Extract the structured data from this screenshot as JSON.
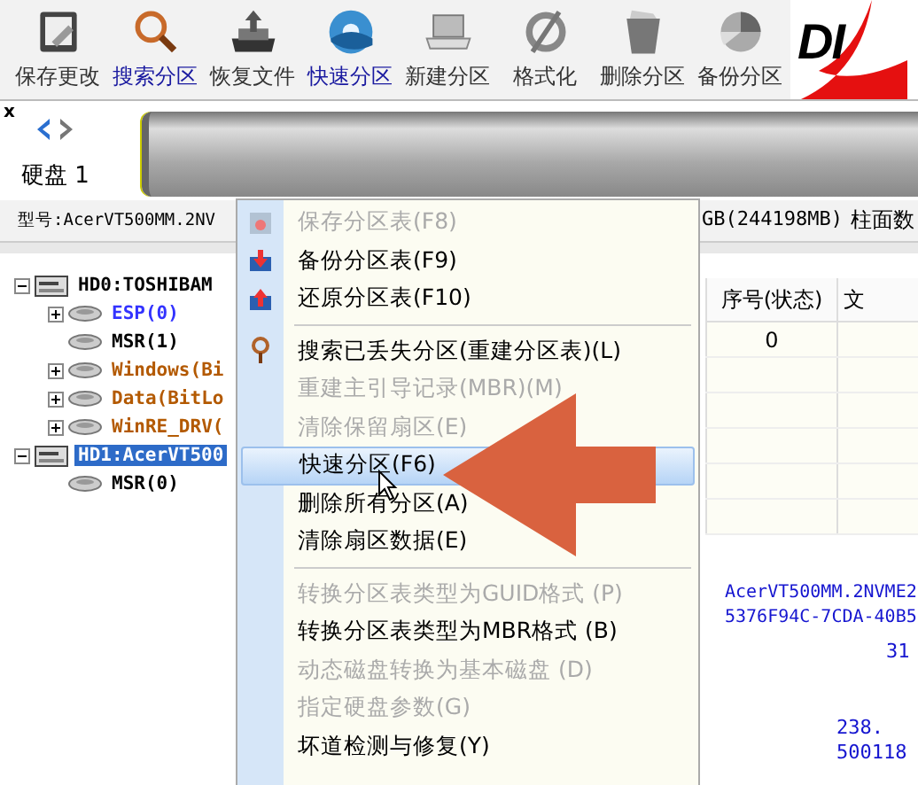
{
  "toolbar": {
    "buttons": [
      {
        "label": "保存更改",
        "kind": "save",
        "highlighted": false
      },
      {
        "label": "搜索分区",
        "kind": "search",
        "highlighted": true
      },
      {
        "label": "恢复文件",
        "kind": "restore",
        "highlighted": false
      },
      {
        "label": "快速分区",
        "kind": "disc",
        "highlighted": true
      },
      {
        "label": "新建分区",
        "kind": "laptop",
        "highlighted": false
      },
      {
        "label": "格式化",
        "kind": "format",
        "highlighted": false
      },
      {
        "label": "删除分区",
        "kind": "trash",
        "highlighted": false
      },
      {
        "label": "备份分区",
        "kind": "backup",
        "highlighted": false
      }
    ],
    "logo_text": "DI"
  },
  "disk_bar": {
    "close": "x",
    "label": "硬盘 1"
  },
  "info_line": {
    "model": "型号:AcerVT500MM.2NV",
    "capacity": "GB(244198MB)",
    "cylinders": "柱面数"
  },
  "tree": [
    {
      "label": "HD0:TOSHIBAM",
      "expanded": true,
      "selected": false,
      "color": "#000000",
      "children": [
        {
          "label": "ESP(0)",
          "expanded": false,
          "selected": false,
          "color": "#3333ff"
        },
        {
          "label": "MSR(1)",
          "selected": false,
          "color": "#000000"
        },
        {
          "label": "Windows(Bi",
          "expanded": false,
          "selected": false,
          "color": "#b35900"
        },
        {
          "label": "Data(BitLo",
          "expanded": false,
          "selected": false,
          "color": "#b35900"
        },
        {
          "label": "WinRE_DRV(",
          "expanded": false,
          "selected": false,
          "color": "#b35900"
        }
      ]
    },
    {
      "label": "HD1:AcerVT500",
      "expanded": true,
      "selected": true,
      "children": [
        {
          "label": "MSR(0)",
          "selected": false,
          "color": "#000000"
        }
      ]
    }
  ],
  "table": {
    "columns": [
      "序号(状态)",
      "文"
    ],
    "rows": [
      [
        "0",
        ""
      ]
    ]
  },
  "details": {
    "lines": [
      "AcerVT500MM.2NVME2",
      "5376F94C-7CDA-40B5"
    ],
    "numbers": [
      "31",
      "238.",
      "500118"
    ]
  },
  "context_menu": {
    "items": [
      {
        "kind": "item",
        "label": "保存分区表(F8)",
        "disabled": true,
        "selected": false
      },
      {
        "kind": "item",
        "label": "备份分区表(F9)",
        "disabled": false,
        "selected": false
      },
      {
        "kind": "item",
        "label": "还原分区表(F10)",
        "disabled": false,
        "selected": false
      },
      {
        "kind": "separator"
      },
      {
        "kind": "item",
        "label": "搜索已丢失分区(重建分区表)(L)",
        "disabled": false,
        "selected": false
      },
      {
        "kind": "item",
        "label": "重建主引导记录(MBR)(M)",
        "disabled": true,
        "selected": false
      },
      {
        "kind": "item",
        "label": "清除保留扇区(E)",
        "disabled": true,
        "selected": false
      },
      {
        "kind": "item",
        "label": "快速分区(F6)",
        "disabled": false,
        "selected": true
      },
      {
        "kind": "item",
        "label": "删除所有分区(A)",
        "disabled": false,
        "selected": false
      },
      {
        "kind": "item",
        "label": "清除扇区数据(E)",
        "disabled": false,
        "selected": false
      },
      {
        "kind": "separator"
      },
      {
        "kind": "item",
        "label": "转换分区表类型为GUID格式 (P)",
        "disabled": true,
        "selected": false
      },
      {
        "kind": "item",
        "label": "转换分区表类型为MBR格式 (B)",
        "disabled": false,
        "selected": false
      },
      {
        "kind": "item",
        "label": "动态磁盘转换为基本磁盘 (D)",
        "disabled": true,
        "selected": false
      },
      {
        "kind": "item",
        "label": "指定硬盘参数(G)",
        "disabled": true,
        "selected": false
      },
      {
        "kind": "item",
        "label": "坏道检测与修复(Y)",
        "disabled": false,
        "selected": false
      }
    ]
  }
}
